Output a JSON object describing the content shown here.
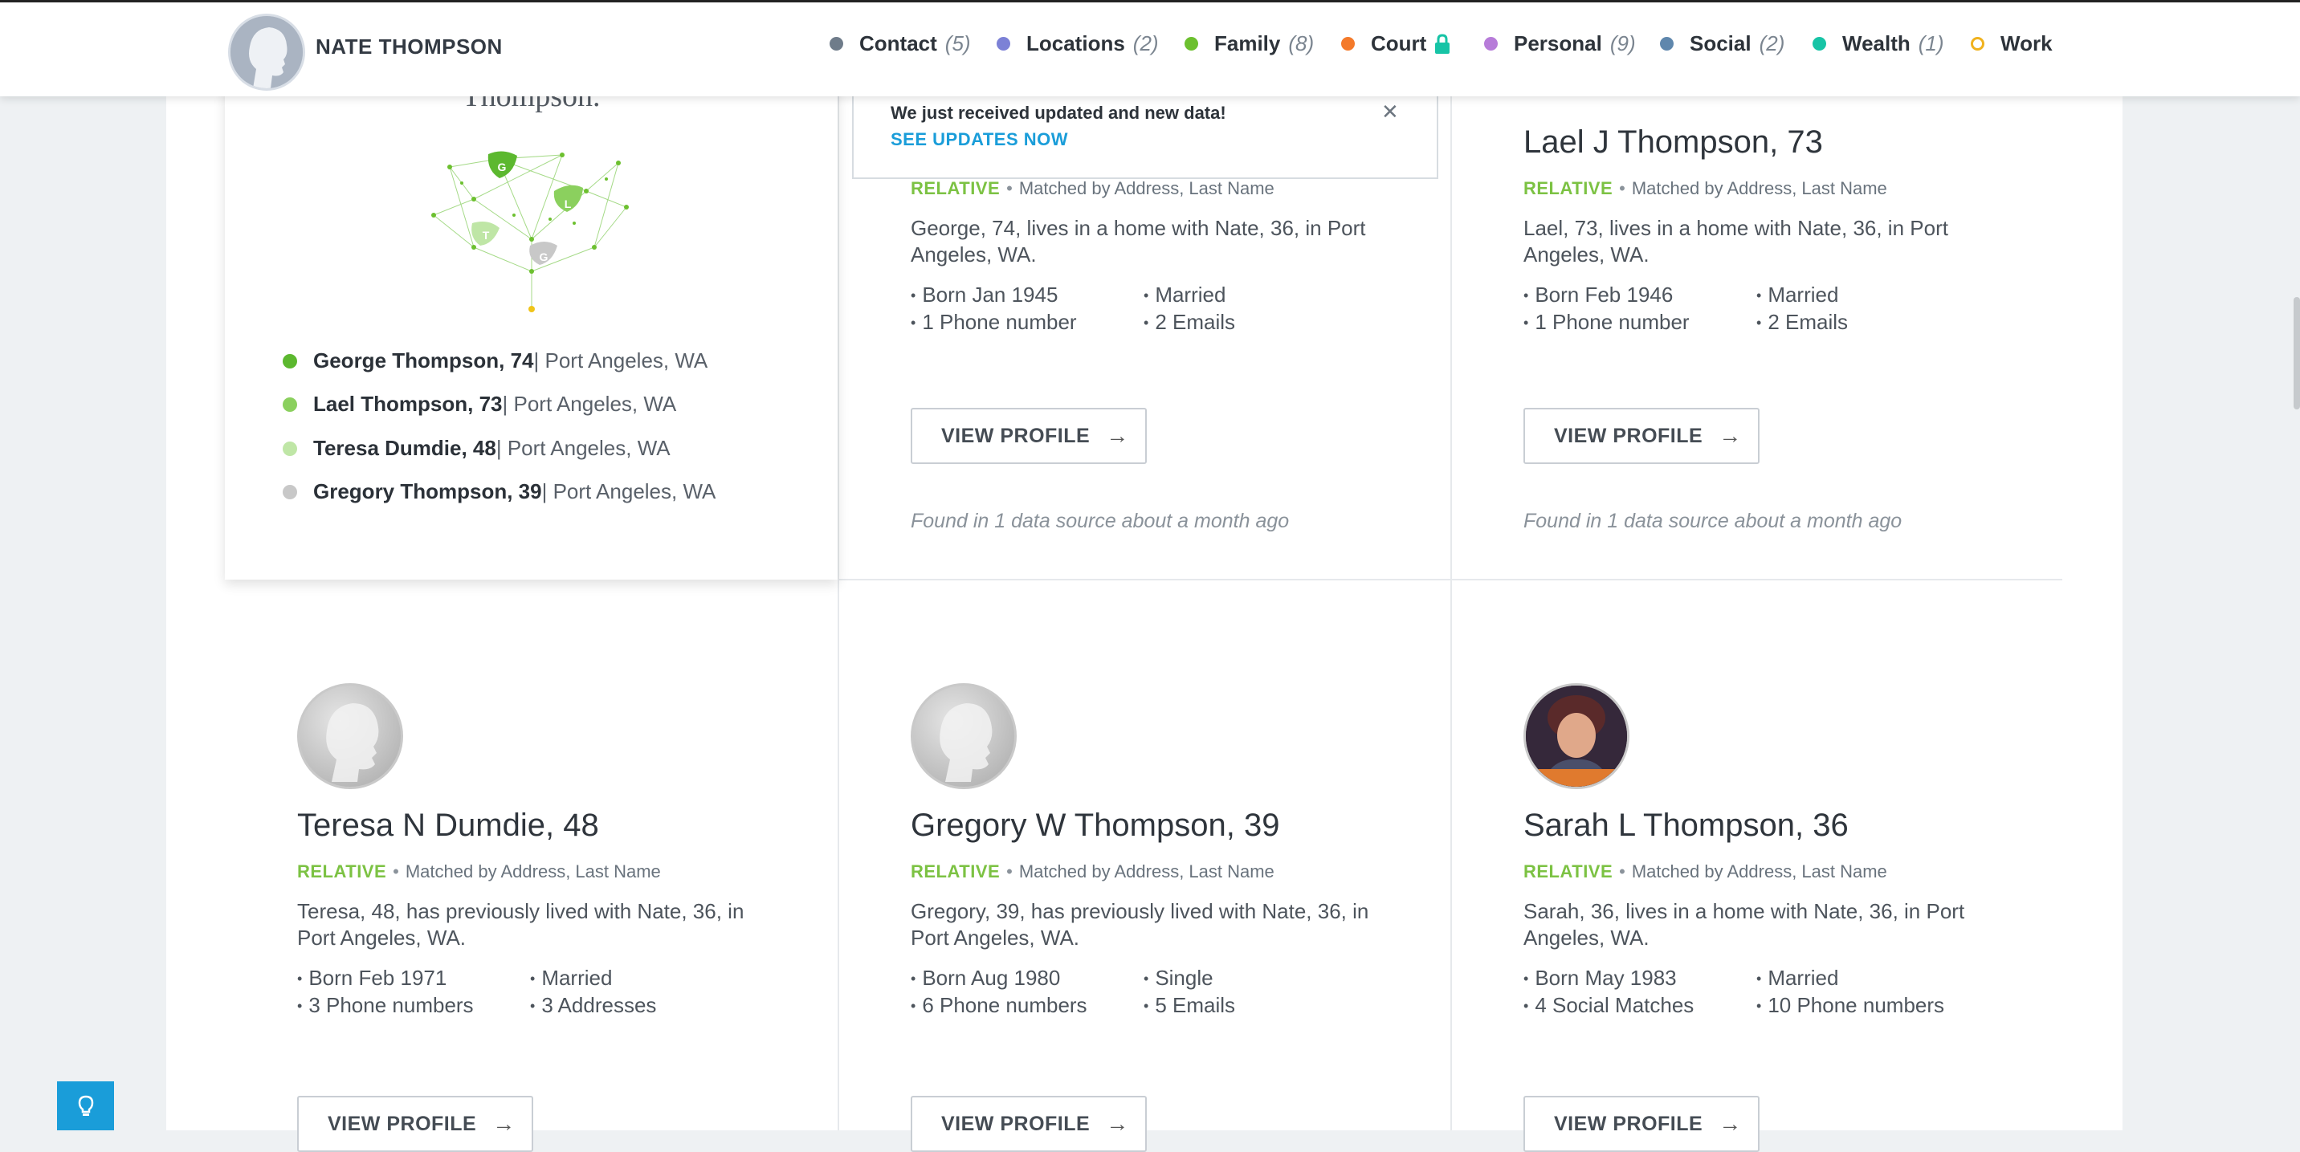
{
  "header": {
    "user_name": "NATE THOMPSON",
    "nav": [
      {
        "label": "Contact",
        "count": "(5)",
        "color": "#6f7c8a"
      },
      {
        "label": "Locations",
        "count": "(2)",
        "color": "#7c81d6"
      },
      {
        "label": "Family",
        "count": "(8)",
        "color": "#6cc02f"
      },
      {
        "label": "Court",
        "count": "",
        "color": "#f47a2a",
        "locked": true
      },
      {
        "label": "Personal",
        "count": "(9)",
        "color": "#b77cd9"
      },
      {
        "label": "Social",
        "count": "(2)",
        "color": "#5f87ad"
      },
      {
        "label": "Wealth",
        "count": "(1)",
        "color": "#17c4a6"
      },
      {
        "label": "Work",
        "count": "",
        "color": "#f0b21e"
      }
    ]
  },
  "toast": {
    "message": "We just received updated and new data!",
    "link": "SEE UPDATES NOW"
  },
  "summary": {
    "title_fragment": "Thompson.",
    "tree_leaves": [
      "G",
      "L",
      "T",
      "G"
    ],
    "relatives": [
      {
        "name": "George Thompson, 74",
        "location": " | Port Angeles, WA",
        "color": "#5cb82f"
      },
      {
        "name": "Lael Thompson, 73",
        "location": " | Port Angeles, WA",
        "color": "#8bd05e"
      },
      {
        "name": "Teresa Dumdie, 48",
        "location": " | Port Angeles, WA",
        "color": "#bfe6a6"
      },
      {
        "name": "Gregory Thompson, 39",
        "location": " | Port Angeles, WA",
        "color": "#c8c8c8"
      }
    ]
  },
  "cards": [
    {
      "name": "",
      "tag": "RELATIVE",
      "match": "Matched by Address, Last Name",
      "desc": "George, 74, lives in a home with Nate, 36, in Port Angeles, WA.",
      "facts": [
        "Born Jan 1945",
        "Married",
        "1 Phone number",
        "2 Emails"
      ],
      "button": "VIEW PROFILE",
      "found": "Found in 1 data source about a month ago"
    },
    {
      "name": "Lael J Thompson, 73",
      "tag": "RELATIVE",
      "match": "Matched by Address, Last Name",
      "desc": "Lael, 73, lives in a home with Nate, 36, in Port Angeles, WA.",
      "facts": [
        "Born Feb 1946",
        "Married",
        "1 Phone number",
        "2 Emails"
      ],
      "button": "VIEW PROFILE",
      "found": "Found in 1 data source about a month ago"
    },
    {
      "name": "Teresa N Dumdie, 48",
      "tag": "RELATIVE",
      "match": "Matched by Address, Last Name",
      "desc": "Teresa, 48, has previously lived with Nate, 36, in Port Angeles, WA.",
      "facts": [
        "Born Feb 1971",
        "Married",
        "3 Phone numbers",
        "3 Addresses"
      ],
      "button": "VIEW PROFILE"
    },
    {
      "name": "Gregory W Thompson, 39",
      "tag": "RELATIVE",
      "match": "Matched by Address, Last Name",
      "desc": "Gregory, 39, has previously lived with Nate, 36, in Port Angeles, WA.",
      "facts": [
        "Born Aug 1980",
        "Single",
        "6 Phone numbers",
        "5 Emails"
      ],
      "button": "VIEW PROFILE"
    },
    {
      "name": "Sarah L Thompson, 36",
      "tag": "RELATIVE",
      "match": "Matched by Address, Last Name",
      "desc": "Sarah, 36, lives in a home with Nate, 36, in Port Angeles, WA.",
      "facts": [
        "Born May 1983",
        "Married",
        "4 Social Matches",
        "10 Phone numbers"
      ],
      "button": "VIEW PROFILE"
    }
  ]
}
